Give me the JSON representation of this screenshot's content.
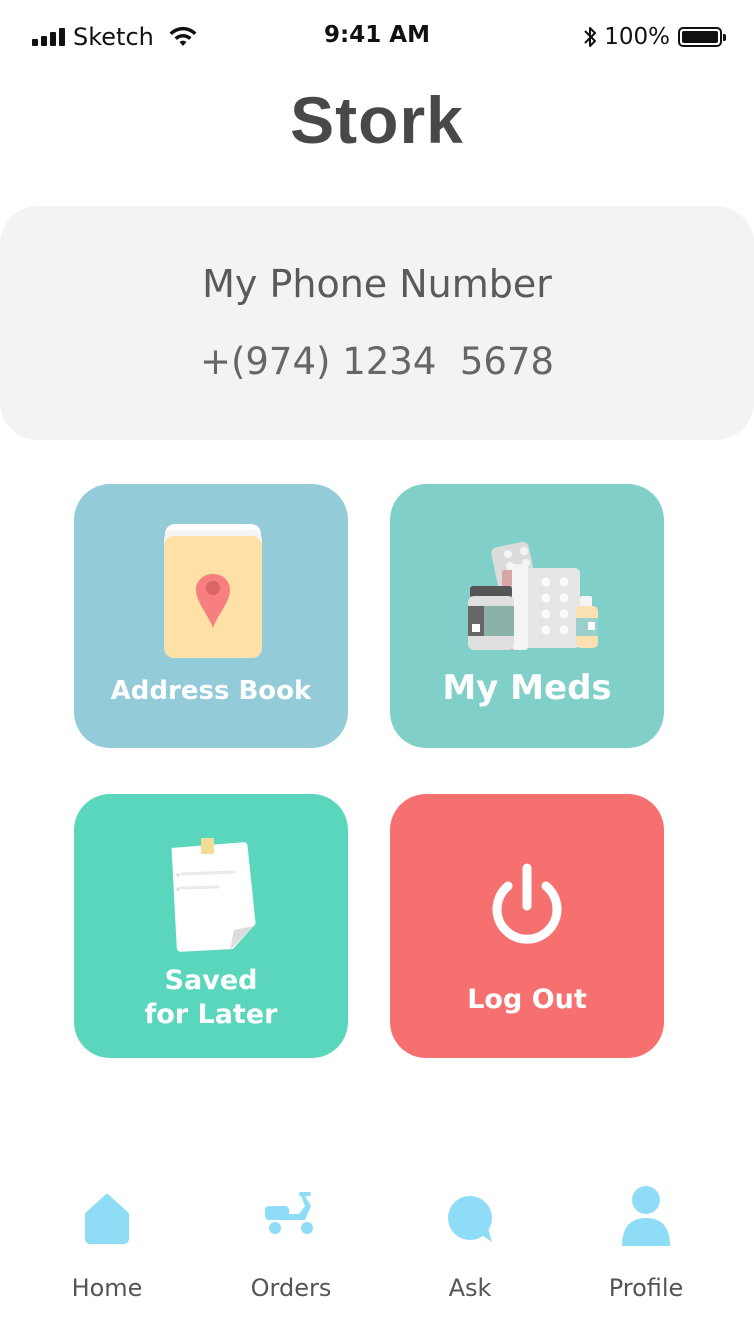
{
  "status_bar": {
    "carrier": "Sketch",
    "time": "9:41 AM",
    "battery_percent": "100%"
  },
  "app": {
    "title": "Stork"
  },
  "phone_card": {
    "label": "My Phone Number",
    "number": "+(974) 1234  5678"
  },
  "tiles": [
    {
      "label": "Address Book",
      "icon": "address-book-pin-icon",
      "color": "#94cbd8"
    },
    {
      "label": "My Meds",
      "icon": "medicine-icon",
      "color": "#80d0c9"
    },
    {
      "label": "Saved\nfor Later",
      "icon": "note-icon",
      "color": "#5ad6bd"
    },
    {
      "label": "Log Out",
      "icon": "power-icon",
      "color": "#f67070"
    }
  ],
  "bottom_nav": {
    "accent": "#8fdcf7",
    "items": [
      {
        "label": "Home",
        "icon": "home-icon"
      },
      {
        "label": "Orders",
        "icon": "scooter-icon"
      },
      {
        "label": "Ask",
        "icon": "chat-bubble-icon"
      },
      {
        "label": "Profile",
        "icon": "person-icon"
      }
    ]
  }
}
